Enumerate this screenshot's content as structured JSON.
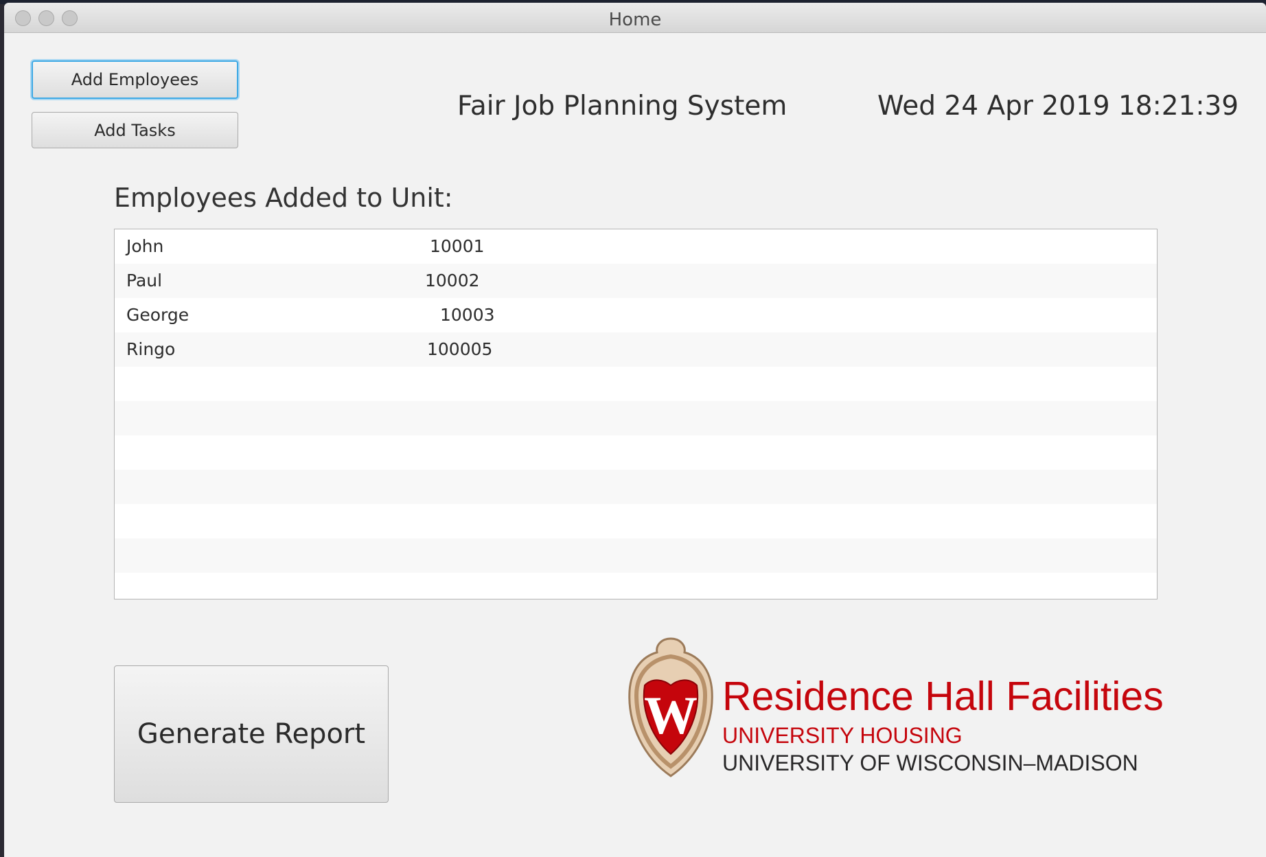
{
  "window": {
    "title": "Home"
  },
  "toolbar": {
    "add_employees_label": "Add Employees",
    "add_tasks_label": "Add Tasks"
  },
  "header": {
    "app_title": "Fair Job Planning System",
    "datetime": "Wed 24 Apr 2019 18:21:39"
  },
  "employees": {
    "section_label": "Employees Added to Unit:",
    "rows": [
      {
        "name": "John",
        "id": "10001"
      },
      {
        "name": "Paul",
        "id": "10002"
      },
      {
        "name": "George",
        "id": "10003"
      },
      {
        "name": "Ringo",
        "id": "100005"
      }
    ]
  },
  "actions": {
    "generate_report_label": "Generate Report"
  },
  "logo": {
    "line1": "Residence Hall Facilities",
    "line2": "UNIVERSITY HOUSING",
    "line3": "UNIVERSITY OF WISCONSIN–MADISON",
    "crest_letter": "W",
    "brand_color": "#c5050c",
    "crest_gold": "#c9a27a"
  }
}
